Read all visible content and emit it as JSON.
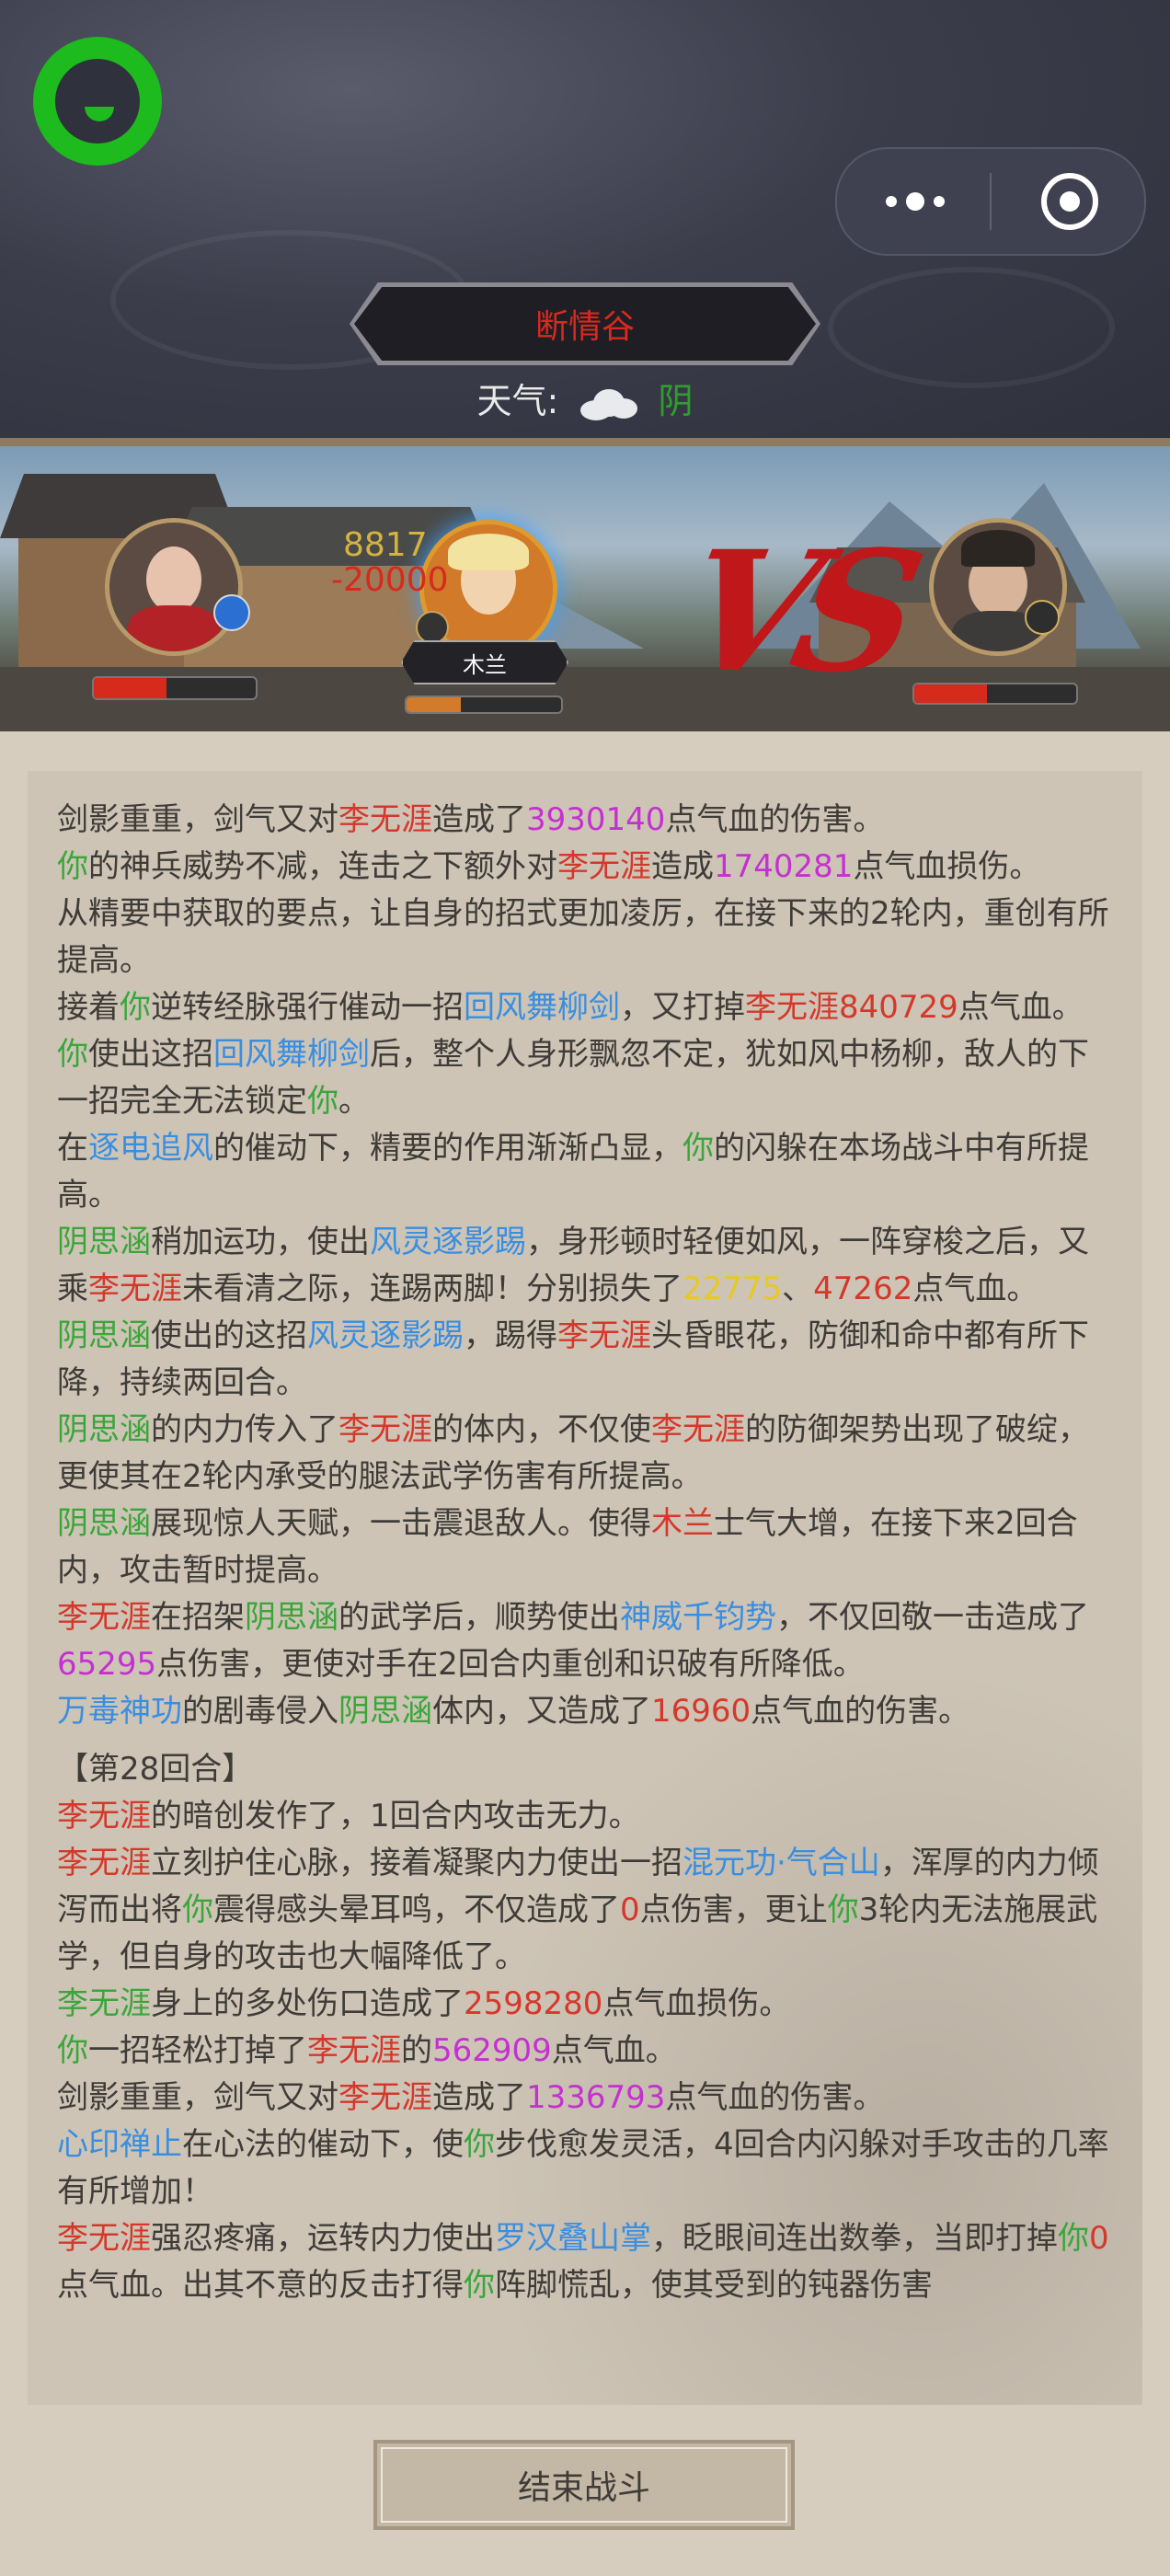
{
  "header": {
    "location": "断情谷",
    "weather_label": "天气:",
    "weather_icon": "cloud-icon",
    "weather_condition": "阴"
  },
  "battle": {
    "damage_top": "8817",
    "damage_bottom": "-20000",
    "ally_name": "木兰",
    "hp": {
      "left": 0.45,
      "ally": 0.35,
      "enemy": 0.45
    }
  },
  "log": [
    [
      {
        "t": "剑影重重，剑气又对"
      },
      {
        "t": "李无涯",
        "c": "n"
      },
      {
        "t": "造成了"
      },
      {
        "t": "3930140",
        "c": "p"
      },
      {
        "t": "点气血的伤害。"
      }
    ],
    [
      {
        "t": "你",
        "c": "g"
      },
      {
        "t": "的神兵威势不减，连击之下额外对"
      },
      {
        "t": "李无涯",
        "c": "n"
      },
      {
        "t": "造成"
      },
      {
        "t": "1740281",
        "c": "p"
      },
      {
        "t": "点气血损伤。"
      }
    ],
    [
      {
        "t": "从精要中获取的要点，让自身的招式更加凌厉，在接下来的2轮内，重创有所提高。"
      }
    ],
    [
      {
        "t": "接着"
      },
      {
        "t": "你",
        "c": "g"
      },
      {
        "t": "逆转经脉强行催动一招"
      },
      {
        "t": "回风舞柳剑",
        "c": "b"
      },
      {
        "t": "，又打掉"
      },
      {
        "t": "李无涯",
        "c": "n"
      },
      {
        "t": "840729",
        "c": "r"
      },
      {
        "t": "点气血。"
      }
    ],
    [
      {
        "t": "你",
        "c": "g"
      },
      {
        "t": "使出这招"
      },
      {
        "t": "回风舞柳剑",
        "c": "b"
      },
      {
        "t": "后，整个人身形飘忽不定，犹如风中杨柳，敌人的下一招完全无法锁定"
      },
      {
        "t": "你",
        "c": "g"
      },
      {
        "t": "。"
      }
    ],
    [
      {
        "t": "在"
      },
      {
        "t": "逐电追风",
        "c": "b"
      },
      {
        "t": "的催动下，精要的作用渐渐凸显，"
      },
      {
        "t": "你",
        "c": "g"
      },
      {
        "t": "的闪躲在本场战斗中有所提高。"
      }
    ],
    [
      {
        "t": "阴思涵",
        "c": "g"
      },
      {
        "t": "稍加运功，使出"
      },
      {
        "t": "风灵逐影踢",
        "c": "b"
      },
      {
        "t": "，身形顿时轻便如风，一阵穿梭之后，又乘"
      },
      {
        "t": "李无涯",
        "c": "n"
      },
      {
        "t": "未看清之际，连踢两脚！分别损失了"
      },
      {
        "t": "22775",
        "c": "y"
      },
      {
        "t": "、"
      },
      {
        "t": "47262",
        "c": "r"
      },
      {
        "t": "点气血。"
      }
    ],
    [
      {
        "t": "阴思涵",
        "c": "g"
      },
      {
        "t": "使出的这招"
      },
      {
        "t": "风灵逐影踢",
        "c": "b"
      },
      {
        "t": "，踢得"
      },
      {
        "t": "李无涯",
        "c": "n"
      },
      {
        "t": "头昏眼花，防御和命中都有所下降，持续两回合。"
      }
    ],
    [
      {
        "t": "阴思涵",
        "c": "g"
      },
      {
        "t": "的内力传入了"
      },
      {
        "t": "李无涯",
        "c": "n"
      },
      {
        "t": "的体内，不仅使"
      },
      {
        "t": "李无涯",
        "c": "n"
      },
      {
        "t": "的防御架势出现了破绽，更使其在2轮内承受的腿法武学伤害有所提高。"
      }
    ],
    [
      {
        "t": "阴思涵",
        "c": "g"
      },
      {
        "t": "展现惊人天赋，一击震退敌人。使得"
      },
      {
        "t": "木兰",
        "c": "n"
      },
      {
        "t": "士气大增，在接下来2回合内，攻击暂时提高。"
      }
    ],
    [
      {
        "t": "李无涯",
        "c": "n"
      },
      {
        "t": "在招架"
      },
      {
        "t": "阴思涵",
        "c": "g"
      },
      {
        "t": "的武学后，顺势使出"
      },
      {
        "t": "神威千钧势",
        "c": "b"
      },
      {
        "t": "，不仅回敬一击造成了"
      },
      {
        "t": "65295",
        "c": "p"
      },
      {
        "t": "点伤害，更使对手在2回合内重创和识破有所降低。"
      }
    ],
    [
      {
        "t": "万毒神功",
        "c": "b"
      },
      {
        "t": "的剧毒侵入"
      },
      {
        "t": "阴思涵",
        "c": "g"
      },
      {
        "t": "体内，又造成了"
      },
      {
        "t": "16960",
        "c": "r"
      },
      {
        "t": "点气血的伤害。"
      }
    ],
    [
      {
        "t": "【第28回合】",
        "round": true
      }
    ],
    [
      {
        "t": "李无涯",
        "c": "n"
      },
      {
        "t": "的暗创发作了，1回合内攻击无力。"
      }
    ],
    [
      {
        "t": "李无涯",
        "c": "n"
      },
      {
        "t": "立刻护住心脉，接着凝聚内力使出一招"
      },
      {
        "t": "混元功·气合山",
        "c": "b"
      },
      {
        "t": "，浑厚的内力倾泻而出将"
      },
      {
        "t": "你",
        "c": "g"
      },
      {
        "t": "震得感头晕耳鸣，不仅造成了"
      },
      {
        "t": "0",
        "c": "r"
      },
      {
        "t": "点伤害，更让"
      },
      {
        "t": "你",
        "c": "g"
      },
      {
        "t": "3轮内无法施展武学，但自身的攻击也大幅降低了。"
      }
    ],
    [
      {
        "t": "李无涯",
        "c": "g"
      },
      {
        "t": "身上的多处伤口造成了"
      },
      {
        "t": "2598280",
        "c": "r"
      },
      {
        "t": "点气血损伤。"
      }
    ],
    [
      {
        "t": "你",
        "c": "g"
      },
      {
        "t": "一招轻松打掉了"
      },
      {
        "t": "李无涯",
        "c": "n"
      },
      {
        "t": "的"
      },
      {
        "t": "562909",
        "c": "p"
      },
      {
        "t": "点气血。"
      }
    ],
    [
      {
        "t": "剑影重重，剑气又对"
      },
      {
        "t": "李无涯",
        "c": "n"
      },
      {
        "t": "造成了"
      },
      {
        "t": "1336793",
        "c": "p"
      },
      {
        "t": "点气血的伤害。"
      }
    ],
    [
      {
        "t": "心印禅止",
        "c": "b"
      },
      {
        "t": "在心法的催动下，使"
      },
      {
        "t": "你",
        "c": "g"
      },
      {
        "t": "步伐愈发灵活，4回合内闪躲对手攻击的几率有所增加！"
      }
    ],
    [
      {
        "t": "李无涯",
        "c": "n"
      },
      {
        "t": "强忍疼痛，运转内力使出"
      },
      {
        "t": "罗汉叠山掌",
        "c": "b"
      },
      {
        "t": "，眨眼间连出数拳，当即打掉"
      },
      {
        "t": "你",
        "c": "g"
      },
      {
        "t": "0",
        "c": "r"
      },
      {
        "t": "点气血。出其不意的反击打得"
      },
      {
        "t": "你",
        "c": "g"
      },
      {
        "t": "阵脚慌乱，使其受到的钝器伤害"
      }
    ]
  ],
  "footer": {
    "end_button": "结束战斗"
  }
}
